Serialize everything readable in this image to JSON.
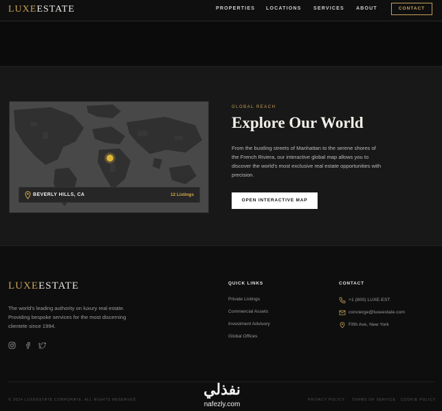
{
  "nav": {
    "logo_part1": "LUXE",
    "logo_part2": "ESTATE",
    "links": [
      "PROPERTIES",
      "LOCATIONS",
      "SERVICES",
      "ABOUT"
    ],
    "contact_label": "CONTACT"
  },
  "explore": {
    "eyebrow": "GLOBAL REACH",
    "title": "Explore Our World",
    "description": "From the bustling streets of Manhattan to the serene shores of the French Riviera, our interactive global map allows you to discover the world's most exclusive real estate opportunities with precision.",
    "cta_label": "OPEN INTERACTIVE MAP",
    "map_card": {
      "city": "BEVERLY HILLS, CA",
      "listings": "12 Listings",
      "pin_icon": "location-pin-icon"
    }
  },
  "footer": {
    "logo_part1": "LUXE",
    "logo_part2": "ESTATE",
    "tagline": "The world's leading authority on luxury real estate. Providing bespoke services for the most discerning clientele since 1994.",
    "social_icons": [
      "instagram-icon",
      "facebook-icon",
      "twitter-icon"
    ],
    "quick_links_heading": "QUICK LINKS",
    "quick_links": [
      "Private Listings",
      "Commercial Assets",
      "Investment Advisory",
      "Global Offices"
    ],
    "contact_heading": "CONTACT",
    "contact": {
      "phone": "+1 (800) LUXE-EST",
      "email": "concierge@luxeestate.com",
      "address": "Fifth Ave, New York"
    },
    "copyright": "© 2024 LUXEESTATE CORPORATE. ALL RIGHTS RESERVED.",
    "legal_links": [
      "PRIVACY POLICY",
      "TERMS OF SERVICE",
      "COOKIE POLICY"
    ]
  },
  "watermark": {
    "arabic": "نفذلي",
    "domain": "nafezly.com"
  },
  "colors": {
    "accent_gold": "#c9a25a",
    "marker_gold": "#e0b63a",
    "background": "#0e0e0e",
    "section_bg": "#181818"
  }
}
